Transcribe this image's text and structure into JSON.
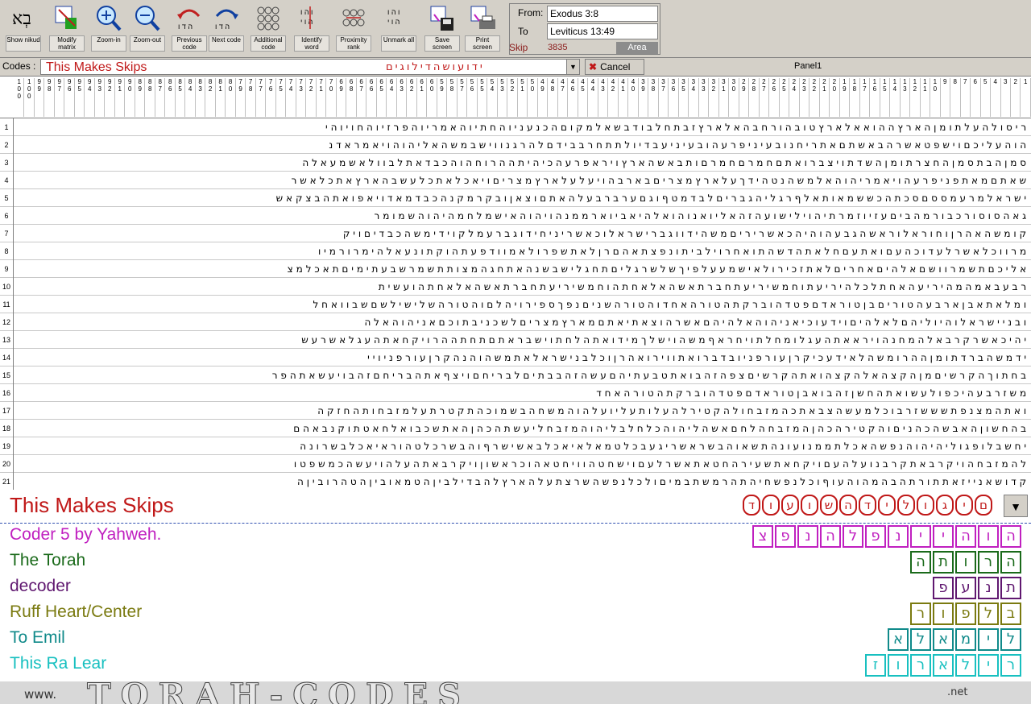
{
  "toolbar": {
    "buttons": [
      {
        "label": "Show nikud",
        "icon": "nikud-icon"
      },
      {
        "label": "Modify matrix",
        "icon": "modify-matrix-icon"
      },
      {
        "label": "Zoom-in",
        "icon": "zoom-in-icon"
      },
      {
        "label": "Zoom-out",
        "icon": "zoom-out-icon"
      },
      {
        "label": "Previous code",
        "icon": "previous-code-icon"
      },
      {
        "label": "Next code",
        "icon": "next-code-icon"
      },
      {
        "label": "Additional code",
        "icon": "additional-code-icon"
      },
      {
        "label": "Identify word",
        "icon": "identify-word-icon"
      },
      {
        "label": "Proximity rank",
        "icon": "proximity-rank-icon"
      },
      {
        "label": "Unmark all",
        "icon": "unmark-all-icon"
      },
      {
        "label": "Save screen",
        "icon": "save-screen-icon"
      },
      {
        "label": "Print screen",
        "icon": "print-screen-icon"
      }
    ],
    "nikud_glyph": "בְּא"
  },
  "range": {
    "from_label": "From:",
    "from_value": "Exodus 3:8",
    "to_label": "To",
    "to_value": "Leviticus 13:49",
    "skip_label": "Skip",
    "skip_value": "3835",
    "area_label": "Area"
  },
  "codes": {
    "label": "Codes :",
    "value": "This Makes Skips",
    "hebrew": "ידועושהדילוגים",
    "cancel_label": "Cancel",
    "panel_label": "Panel1"
  },
  "matrix": {
    "col_headers": [
      "1 0 0",
      "1 0 0",
      "9 9",
      "9 8",
      "9 7",
      "9 6",
      "9 5",
      "9 4",
      "9 3",
      "9 2",
      "9 1",
      "9 0",
      "8 9",
      "8 8",
      "8 7",
      "8 6",
      "8 5",
      "8 4",
      "8 3",
      "8 2",
      "8 1",
      "8 0",
      "7 9",
      "7 8",
      "7 7",
      "7 6",
      "7 5",
      "7 4",
      "7 3",
      "7 2",
      "7 1",
      "7 0",
      "6 9",
      "6 8",
      "6 7",
      "6 6",
      "6 5",
      "6 4",
      "6 3",
      "6 2",
      "6 1",
      "6 0",
      "5 9",
      "5 8",
      "5 7",
      "5 6",
      "5 5",
      "5 4",
      "5 3",
      "5 2",
      "5 1",
      "5 0",
      "4 9",
      "4 8",
      "4 7",
      "4 6",
      "4 5",
      "4 4",
      "4 3",
      "4 2",
      "4 1",
      "4 0",
      "3 9",
      "3 8",
      "3 7",
      "3 6",
      "3 5",
      "3 4",
      "3 3",
      "3 2",
      "3 1",
      "3 0",
      "2 9",
      "2 8",
      "2 7",
      "2 6",
      "2 5",
      "2 4",
      "2 3",
      "2 2",
      "2 1",
      "2 0",
      "1 9",
      "1 8",
      "1 7",
      "1 6",
      "1 5",
      "1 4",
      "1 3",
      "1 2",
      "1 1",
      "1 0",
      "9",
      "8",
      "7",
      "6",
      "5",
      "4",
      "3",
      "2",
      "1"
    ],
    "rows": [
      "ריסולהעלתומןהארץההואאלארץטובהורחבהאלארץזבתחלבודבשאלמקוםהכנעניוהחתיוהאמריוהפרזיוהחויוהי",
      "הוהעליכםוישפטאשרהבאשתםאתריחנובעיניפרעהובעיניעבדיולתתחרבבידםלהרגנווישבמשהאליהוהויאמראדנ",
      "סמןהבתסמןהחצרתומןהשדתויצברואתםחמרםחמרםותבאשהארץויראפרעהכיהיתההרוחהוהכבדאתלבוולאשמעאלה",
      "שאתםמאתפניפרעהויאמריהוהאלמשהנטהידךעלארץמצריםבארבהויעלעלארץמצריםויאכלאתכלעשבהארץאתכלאשר",
      "ישראלמרעמססםסכתהכששמאותאלףרגליהגבריםלבדמטףוגםערברבעלהאתםוצאןובקרמקנהכבדמאדויאפואתהבצקאש",
      "גאהסוסורכבורמהביםעזיוזמרתיהוילישועהזהאליואנוהואלהיאביוארממנהויהוהאישמלחמהיהוהשמומר",
      "קומשהאהרןוחוראלוראשהגבעהוהיהכאשריריםמשהידווגברישראלוכאשריניחידוגברעמלקוידימשהכבדיםויק",
      "מרווכלאשרלעדוכהעםואתעםחלאתהדשהתואחרוילביתונפצתאהםרןלאתשפרולאמוודפעתהוקתונעאלהימרורמיו",
      "אליכםתשמרוושםאלהיםאחריםלאתזכירולאישמעעלפיךשלשרגליםתחגלישבשנהאתחגהמצותתשמרשבעתימיםתאכלמצ",
      "רבעבאמהמהיריעהאחתלכלהיריעתוחמשיריעתחברתאשהאלאחתהוחמשיריעתחברתאשהאלאחתהועשית",
      "ומלאתאבןארבעהטוריםבןטוראדםפטדהוברקתהטורהאחדוהטורהשניםנפךספירויהלםוהטורהשלישילשםשבוואחל",
      "ובניישראלוהיוליהםלאלהיםוידעוכיאניהוהאלהיהםאשרהוצאתיאתםמארץמצריםלשכניבתוכםאניהוהאלה",
      "יהיכאשרקרבאלהמחנהויראאתהעגלומחלתויחראףמשהוישלךמידואתהלחתוישבראתםתחתההרויקחאתהעגלאשרעש",
      "ידמשהברדתומןההרומשהלאידעכיקרןעורפניובדברואתווירואהרןוכלבנישראלאתמשהוהנהקרןעורפניויי",
      "בחתוךהקרשיםמןהקצהאלהקצהואתהקרשיםצפהזהבואתטבעתיהםעשהזהבבתיםלבריחםויצףאתהבריחםזהבויעשאתהפר",
      "משזרבעהיכפולעשואתהחשןזהבואבןטוראדםפטדהוברקתהטורהאחד",
      "ואתהמצנפתשששזרבוכלמעשהצבאתכהמזבחולהקטירלהעלותעליועלהוהמשחהבשמוכהתקטרתעלמזבחותהחזקה",
      "בהחשוןהאבשהכהניםוהקטירהכהןהמזבחהלחםאשהליהוהכלחלבליהוהמזבחליעשתהכהןהאתשכבואלחאטתוקנבאהם",
      "יחשבלופגוליהיהוהנפשהאכלתממנועונהתשאוהבשראשריגעבכלטמאלאיאכלבאשישרףוהבשרכלטהוראיאכלבשרונה",
      "להמזבחהויקרבאתקרבנועלהעםויקחאתשעירהחטאתאשרלעםוישחטהוויחטאהוכראשוןויקרבאתהעלהויעשהכמשפטו",
      "קדושאנייזאתתורתהבהמהוהעוףוכלנפשחיהתהרמשתבמיםולכלנפשהשרצתעלהארץלהבדילביןהטמאוביןהטהרוביןה"
    ]
  },
  "code_title": {
    "text": "This Makes Skips",
    "hebrew_letters": [
      "ד",
      "ו",
      "ע",
      "ו",
      "ש",
      "ה",
      "ד",
      "י",
      "ל",
      "ו",
      "ג",
      "י",
      "ם"
    ],
    "color": "#c01818"
  },
  "legend": {
    "items": [
      {
        "text": "Coder 5 by Yahweh.",
        "color": "#c020c0",
        "hebrew": [
          "צ",
          "פ",
          "נ",
          "ה",
          "ל",
          "פ",
          "נ",
          "י",
          "י",
          "ה",
          "ו",
          "ה"
        ]
      },
      {
        "text": "The Torah",
        "color": "#1a6a1a",
        "hebrew": [
          "ה",
          "ת",
          "ו",
          "ר",
          "ה"
        ]
      },
      {
        "text": "decoder",
        "color": "#601870",
        "hebrew": [
          "פ",
          "ע",
          "נ",
          "ת"
        ]
      },
      {
        "text": "Ruff Heart/Center",
        "color": "#7a7a10",
        "hebrew": [
          "ר",
          "ו",
          "פ",
          "ל",
          "ב"
        ]
      },
      {
        "text": "To Emil",
        "color": "#108a8a",
        "hebrew": [
          "א",
          "ל",
          "א",
          "מ",
          "י",
          "ל"
        ]
      },
      {
        "text": "This Ra Lear",
        "color": "#18c0c0",
        "hebrew": [
          "ז",
          "ו",
          "ר",
          "א",
          "ל",
          "י",
          "ר"
        ]
      }
    ]
  },
  "brand": {
    "www": "www.",
    "main": "TORAH-CODES",
    "net": ".net"
  }
}
